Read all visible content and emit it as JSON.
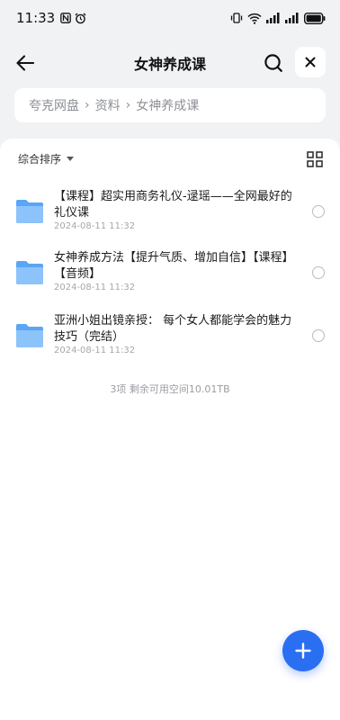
{
  "status_bar": {
    "time": "11:33",
    "left_icons": [
      "nfc-icon",
      "alarm-icon"
    ],
    "right_icons": [
      "vibrate-icon",
      "wifi-icon",
      "signal-icon",
      "signal-icon",
      "battery-icon"
    ]
  },
  "nav": {
    "title": "女神养成课",
    "back_icon": "arrow-left-icon",
    "search_icon": "search-icon",
    "close_icon": "close-icon"
  },
  "breadcrumb": {
    "items": [
      "夸克网盘",
      "资料",
      "女神养成课"
    ],
    "separator": "›"
  },
  "toolbar": {
    "sort_label": "综合排序",
    "sort_icon": "caret-down-icon",
    "view_icon": "grid-view-icon"
  },
  "files": [
    {
      "name": "【课程】超实用商务礼仪-逯瑶——全网最好的礼仪课",
      "date": "2024-08-11 11:32",
      "icon": "folder-icon"
    },
    {
      "name": "女神养成方法【提升气质、增加自信】【课程】【音频】",
      "date": "2024-08-11 11:32",
      "icon": "folder-icon"
    },
    {
      "name": "亚洲小姐出镜亲授： 每个女人都能学会的魅力技巧（完结）",
      "date": "2024-08-11 11:32",
      "icon": "folder-icon"
    }
  ],
  "footer": {
    "info": "3项 剩余可用空间10.01TB"
  },
  "fab": {
    "icon": "plus-icon"
  },
  "colors": {
    "accent": "#2a6ff2",
    "folder": "#5aa6f5",
    "background": "#f1f2f4"
  }
}
